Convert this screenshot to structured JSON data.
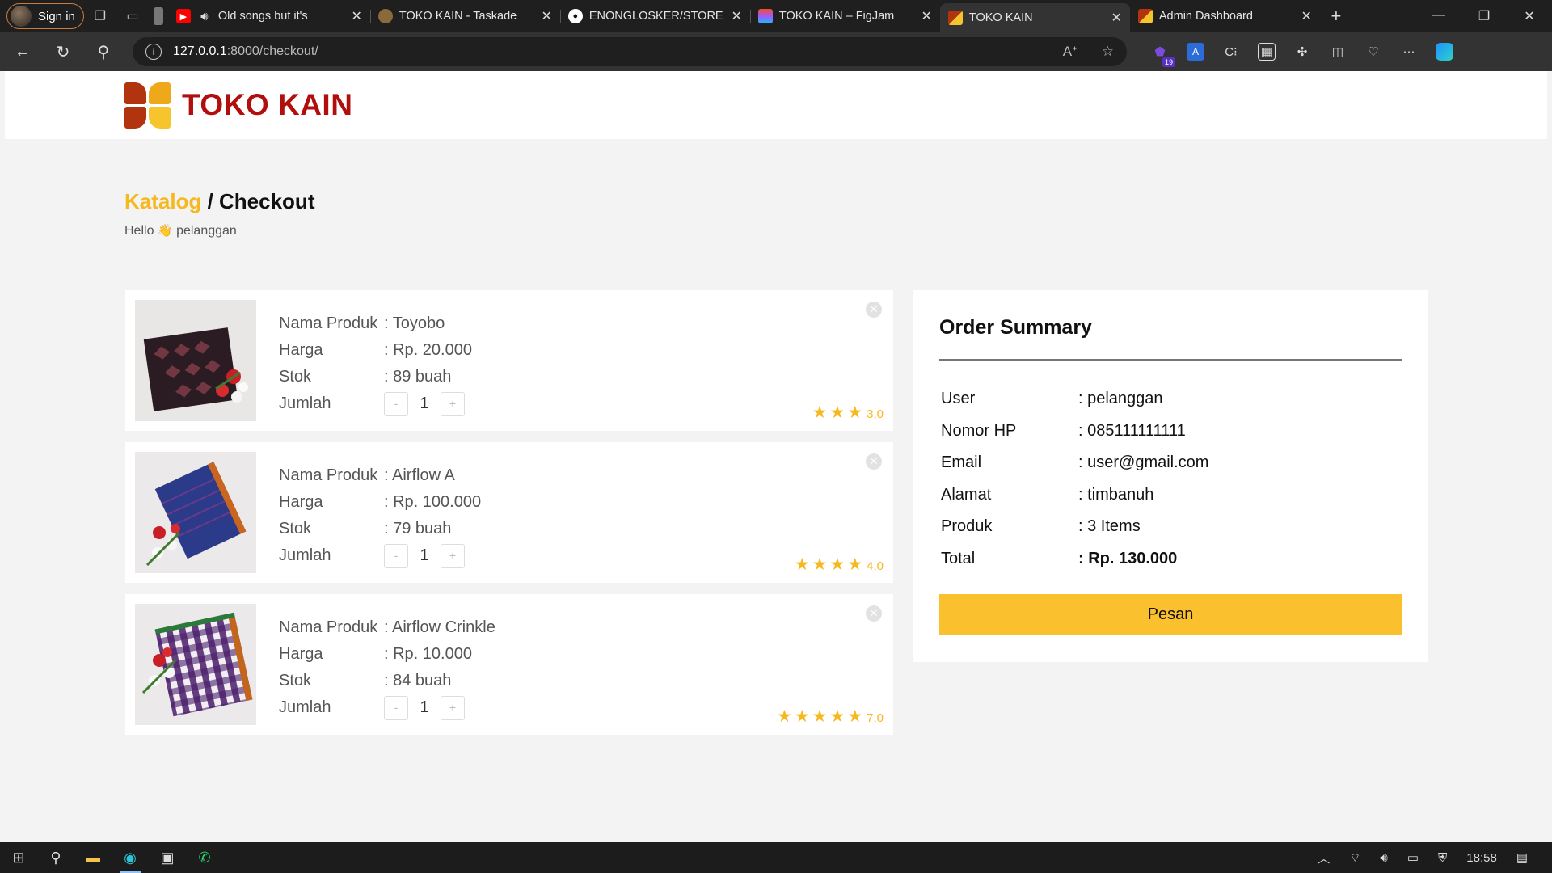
{
  "browser": {
    "profile_label": "Sign in",
    "tabs": [
      {
        "title": "Old songs but it's",
        "fav_color": "#ff0000"
      },
      {
        "title": "TOKO KAIN - Taskade",
        "fav_color": "#8a6a3a"
      },
      {
        "title": "ENONGLOSKER/STORE",
        "fav_color": "#333333"
      },
      {
        "title": "TOKO KAIN – FigJam",
        "fav_color": "#a259ff"
      },
      {
        "title": "TOKO KAIN",
        "fav_color": "#f0a81b"
      },
      {
        "title": "Admin Dashboard",
        "fav_color": "#f0a81b"
      }
    ],
    "url_host": "127.0.0.1",
    "url_path": ":8000/checkout/",
    "ext_badge": "19"
  },
  "site": {
    "brand": "TOKO KAIN",
    "breadcrumb_link": "Katalog",
    "breadcrumb_sep": " / ",
    "breadcrumb_current": "Checkout",
    "hello_prefix": "Hello",
    "hello_user": "pelanggan"
  },
  "labels": {
    "name": "Nama Produk",
    "price": "Harga",
    "stock": "Stok",
    "qty": "Jumlah"
  },
  "products": [
    {
      "name": ": Toyobo",
      "price": ": Rp. 20.000",
      "stock": ": 89 buah",
      "qty": "1",
      "stars": 3,
      "rating": "3,0"
    },
    {
      "name": ": Airflow A",
      "price": ": Rp. 100.000",
      "stock": ": 79 buah",
      "qty": "1",
      "stars": 4,
      "rating": "4,0"
    },
    {
      "name": ": Airflow Crinkle",
      "price": ": Rp. 10.000",
      "stock": ": 84 buah",
      "qty": "1",
      "stars": 5,
      "rating": "7,0"
    }
  ],
  "summary": {
    "title": "Order Summary",
    "rows": [
      {
        "k": "User",
        "v": ": pelanggan"
      },
      {
        "k": "Nomor HP",
        "v": ": 085111111111"
      },
      {
        "k": "Email",
        "v": ": user@gmail.com"
      },
      {
        "k": "Alamat",
        "v": ": timbanuh"
      },
      {
        "k": "Produk",
        "v": ": 3 Items"
      },
      {
        "k": "Total",
        "v": ": Rp. 130.000"
      }
    ],
    "button": "Pesan"
  },
  "taskbar": {
    "time": "18:58"
  },
  "colors": {
    "accent": "#fbc02d",
    "brand": "#b10e0e",
    "star": "#f6b81e"
  }
}
